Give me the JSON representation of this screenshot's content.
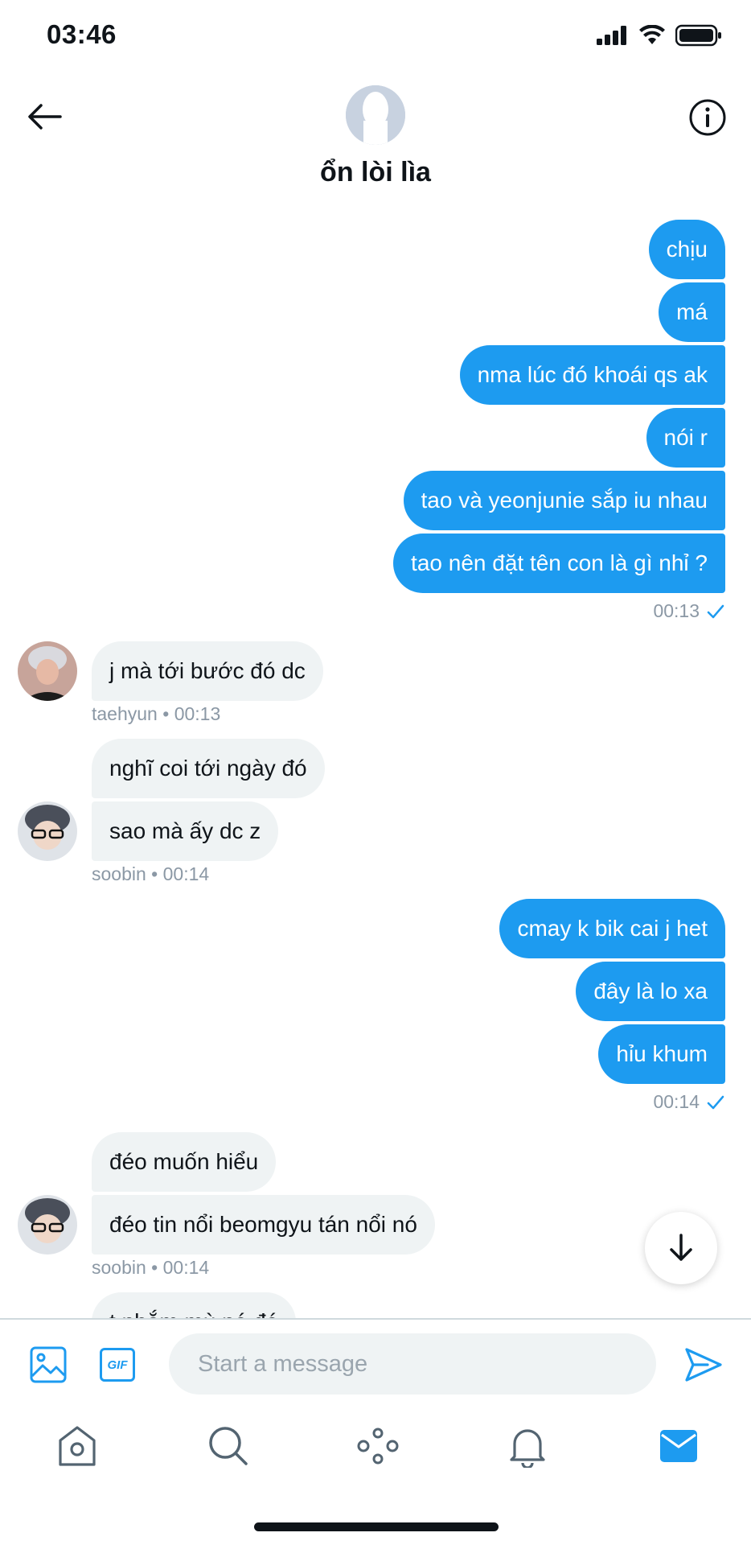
{
  "status_bar": {
    "time": "03:46"
  },
  "header": {
    "title": "ổn lòi lìa"
  },
  "colors": {
    "accent": "#1d9bf0",
    "incoming_bubble": "#eff3f4",
    "meta_text": "#8b98a5"
  },
  "messages": {
    "group1": [
      "chịu",
      "má",
      "nma lúc đó khoái qs ak",
      "nói r",
      "tao và yeonjunie sắp iu nhau",
      "tao nên đặt tên con là gì nhỉ ?"
    ],
    "group1_time": "00:13",
    "taehyun_msg": "j mà tới bước đó dc",
    "taehyun_sender": "taehyun",
    "taehyun_time": "00:13",
    "soobin1": [
      "nghĩ coi tới ngày đó",
      "sao mà ấy dc z"
    ],
    "soobin1_sender": "soobin",
    "soobin1_time": "00:14",
    "group2": [
      "cmay k bik cai j het",
      "đây là lo xa",
      "hỉu khum"
    ],
    "group2_time": "00:14",
    "soobin2": [
      "đéo muốn hiểu",
      "đéo tin nổi beomgyu tán nổi nó"
    ],
    "soobin2_sender": "soobin",
    "soobin2_time": "00:14",
    "partial": "t nhắm mù nó đó"
  },
  "composer": {
    "placeholder": "Start a message",
    "gif_label": "GIF"
  },
  "icons": [
    "back-arrow-icon",
    "info-icon",
    "image-icon",
    "gif-icon",
    "send-icon",
    "scroll-down-arrow-icon",
    "home-icon",
    "search-icon",
    "spaces-icon",
    "notifications-icon",
    "messages-icon"
  ]
}
